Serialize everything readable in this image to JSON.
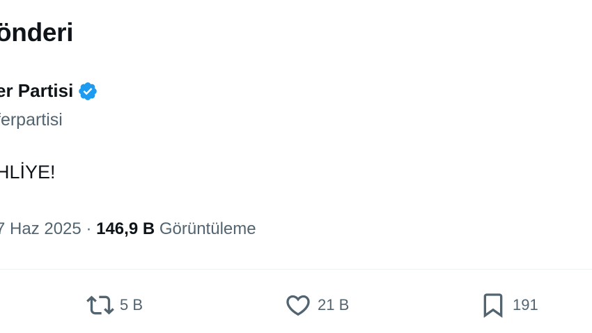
{
  "header": {
    "title": "önderi"
  },
  "author": {
    "name": "er Partisi",
    "handle": "ferpartisi",
    "verified_color": "#1d9bf0"
  },
  "tweet": {
    "text": "HLİYE!"
  },
  "meta": {
    "date": "7 Haz 2025",
    "separator": "·",
    "views_count": "146,9 B",
    "views_label": "Görüntüleme"
  },
  "actions": {
    "retweet_count": "5 B",
    "like_count": "21 B",
    "bookmark_count": "191",
    "icon_color": "#536471"
  }
}
